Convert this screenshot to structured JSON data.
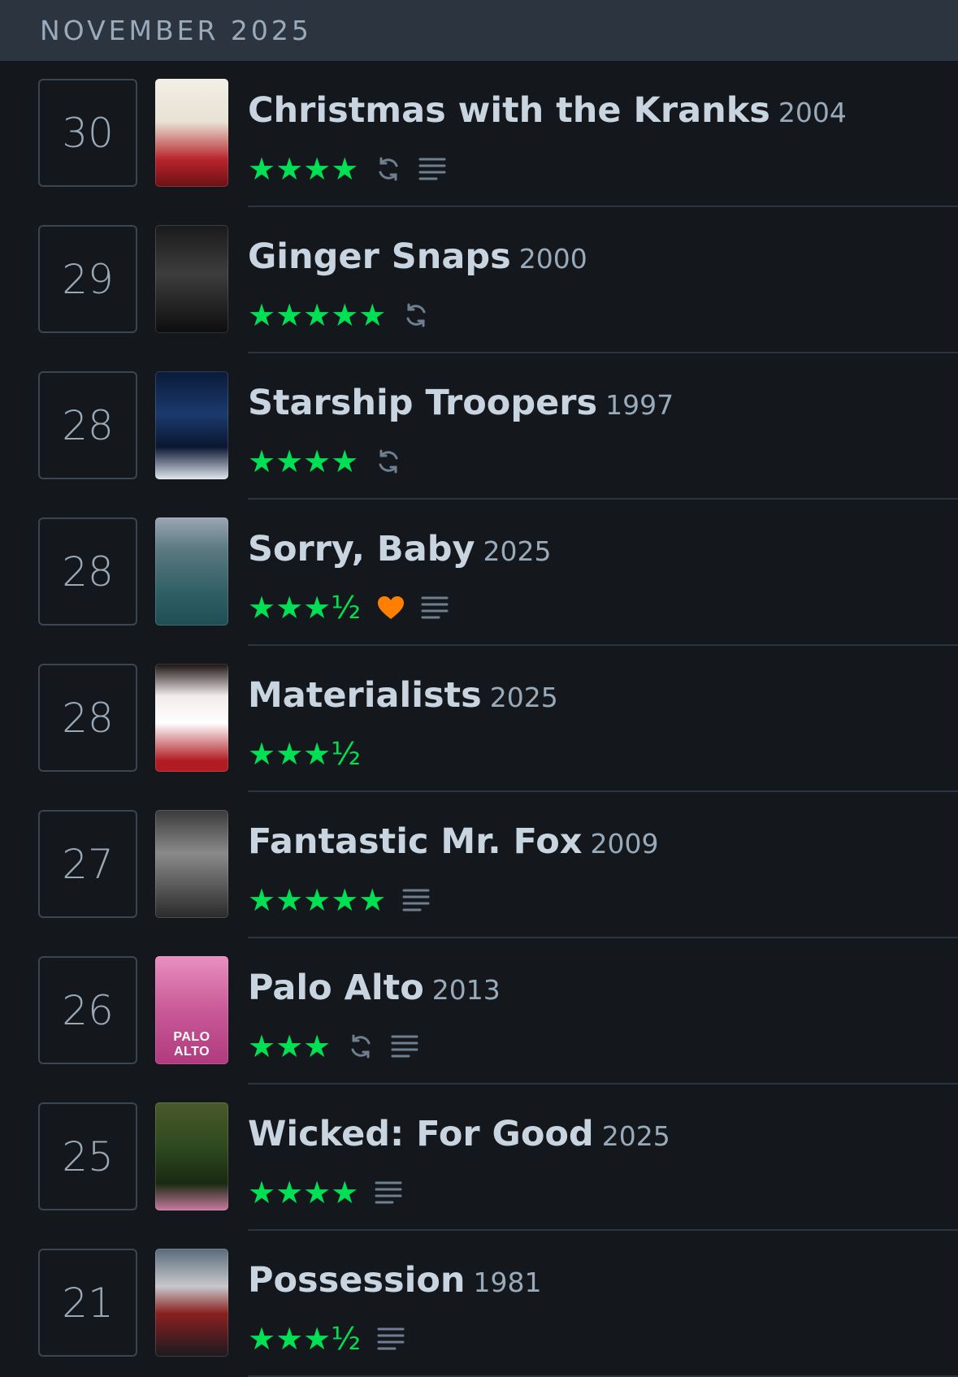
{
  "header": {
    "month": "NOVEMBER 2025"
  },
  "entries": [
    {
      "day": "30",
      "title": "Christmas with the Kranks",
      "year": "2004",
      "rating": "★★★★",
      "rewatch": true,
      "liked": false,
      "review": true,
      "poster": {
        "bg": "linear-gradient(180deg,#f3efe6 0%,#e8e2d4 40%,#b8232a 75%,#6b1218 100%)",
        "label": ""
      }
    },
    {
      "day": "29",
      "title": "Ginger Snaps",
      "year": "2000",
      "rating": "★★★★★",
      "rewatch": true,
      "liked": false,
      "review": false,
      "poster": {
        "bg": "linear-gradient(180deg,#1a1a1a 0%,#3d3d3d 45%,#0d0d0d 100%)",
        "label": ""
      }
    },
    {
      "day": "28",
      "title": "Starship Troopers",
      "year": "1997",
      "rating": "★★★★",
      "rewatch": true,
      "liked": false,
      "review": false,
      "poster": {
        "bg": "linear-gradient(180deg,#0a1a3a 0%,#1b3a6d 40%,#0b1630 70%,#dfe6ee 100%)",
        "label": ""
      }
    },
    {
      "day": "28",
      "title": "Sorry, Baby",
      "year": "2025",
      "rating": "★★★½",
      "rewatch": false,
      "liked": true,
      "review": true,
      "poster": {
        "bg": "linear-gradient(180deg,#9aa7b5 0%,#5b7880 30%,#2f5f64 70%,#1f4f56 100%)",
        "label": ""
      }
    },
    {
      "day": "28",
      "title": "Materialists",
      "year": "2025",
      "rating": "★★★½",
      "rewatch": false,
      "liked": false,
      "review": false,
      "poster": {
        "bg": "linear-gradient(180deg,#1a1010 0%,#f2ecec 30%,#ffffff 55%,#b01c22 90%)",
        "label": ""
      }
    },
    {
      "day": "27",
      "title": "Fantastic Mr. Fox",
      "year": "2009",
      "rating": "★★★★★",
      "rewatch": false,
      "liked": false,
      "review": true,
      "poster": {
        "bg": "linear-gradient(180deg,#3a3a3a 0%,#8a8a8a 40%,#5a5a5a 70%,#2a2a2a 100%)",
        "label": ""
      }
    },
    {
      "day": "26",
      "title": "Palo Alto",
      "year": "2013",
      "rating": "★★★",
      "rewatch": true,
      "liked": false,
      "review": true,
      "poster": {
        "bg": "linear-gradient(180deg,#e98fbf 0%,#c85a98 50%,#b03a7d 100%)",
        "label": "PALO ALTO"
      }
    },
    {
      "day": "25",
      "title": "Wicked: For Good",
      "year": "2025",
      "rating": "★★★★",
      "rewatch": false,
      "liked": false,
      "review": true,
      "poster": {
        "bg": "linear-gradient(180deg,#4a5a2a 0%,#2f4a1f 40%,#1a2a12 75%,#c97aa0 100%)",
        "label": ""
      }
    },
    {
      "day": "21",
      "title": "Possession",
      "year": "1981",
      "rating": "★★★½",
      "rewatch": false,
      "liked": false,
      "review": true,
      "poster": {
        "bg": "linear-gradient(180deg,#5a6a7a 0%,#c8c8cc 35%,#8a2020 60%,#1a1a20 100%)",
        "label": ""
      }
    }
  ],
  "colors": {
    "star": "#00e054",
    "heart": "#ff8000",
    "icon": "#6f7f8f"
  }
}
